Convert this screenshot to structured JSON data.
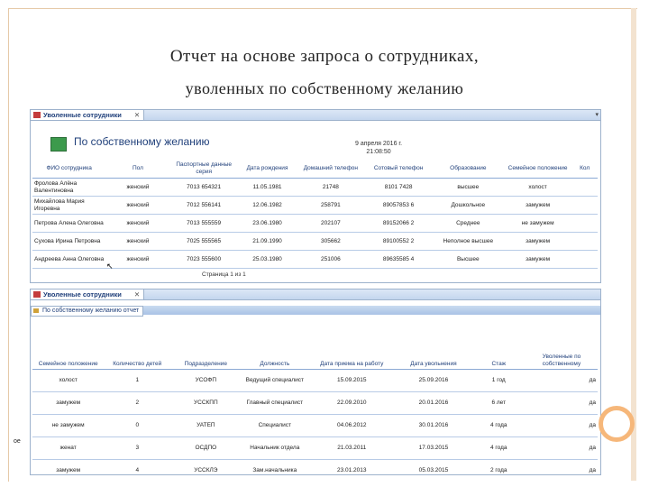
{
  "slide": {
    "title_line1": "Отчет на основе запроса о сотрудниках,",
    "title_line2": "уволенных по собственному желанию"
  },
  "window1": {
    "tab_label": "Уволенные сотрудники",
    "tab_close": "✕",
    "scroll_btn": "▾",
    "report_title": "По собственному желанию",
    "report_date_line1": "9 апреля 2016 г.",
    "report_date_line2": "21:08:50",
    "columns": [
      "ФИО сотрудника",
      "Пол",
      "Паспортные данные серия",
      "Дата рождения",
      "Домашний телефон",
      "Сотовый телефон",
      "Образование",
      "Семейное положение",
      "Кол"
    ],
    "rows": [
      [
        "Фролова Алёна Валентиновна",
        "женский",
        "7013 654321",
        "11.05.1981",
        "21748",
        "8101 7428",
        "высшее",
        "холост",
        ""
      ],
      [
        "Михайлова Мария Игоревна",
        "женский",
        "7012 556141",
        "12.06.1982",
        "258791",
        "89057853 6",
        "Дошкольное",
        "замужем",
        ""
      ],
      [
        "Петрова Алена Олеговна",
        "женский",
        "7013 555559",
        "23.06.1980",
        "202107",
        "89152066 2",
        "Среднее",
        "не замужем",
        ""
      ],
      [
        "Сухова Ирина Петровна",
        "женский",
        "7025 555565",
        "21.09.1990",
        "305662",
        "89100552 2",
        "Неполное высшее",
        "замужем",
        ""
      ],
      [
        "Андреева Анна Олеговна",
        "женский",
        "7023 555600",
        "25.03.1980",
        "251006",
        "89635585 4",
        "Высшее",
        "замужем",
        ""
      ]
    ],
    "cursor": "↖",
    "pager": "Страница 1 из 1"
  },
  "window2": {
    "tab_label": "Уволенные сотрудники",
    "tab_close": "✕",
    "subtab_label": "По собственному желанию отчет",
    "columns": [
      "Семейное положение",
      "Количество детей",
      "Подразделение",
      "Должность",
      "Дата приема на работу",
      "Дата увольнения",
      "Стаж",
      "Уволенные по собственному"
    ],
    "rows": [
      [
        "холост",
        "1",
        "УСОФП",
        "Ведущий специалист",
        "15.09.2015",
        "25.09.2016",
        "1 год",
        "да"
      ],
      [
        "замужем",
        "2",
        "УССКПП",
        "Главный специалист",
        "22.09.2010",
        "20.01.2016",
        "6 лет",
        "да"
      ],
      [
        "не замужем",
        "0",
        "УАТЕП",
        "Специалист",
        "04.06.2012",
        "30.01.2016",
        "4 года",
        "да"
      ],
      [
        "женат",
        "3",
        "ОСДПО",
        "Начальник отдела",
        "21.03.2011",
        "17.03.2015",
        "4 года",
        "да"
      ],
      [
        "замужем",
        "4",
        "УССКЛЭ",
        "Зам.начальника",
        "23.01.2013",
        "05.03.2015",
        "2 года",
        "да"
      ]
    ],
    "left_fragment": "ое"
  }
}
